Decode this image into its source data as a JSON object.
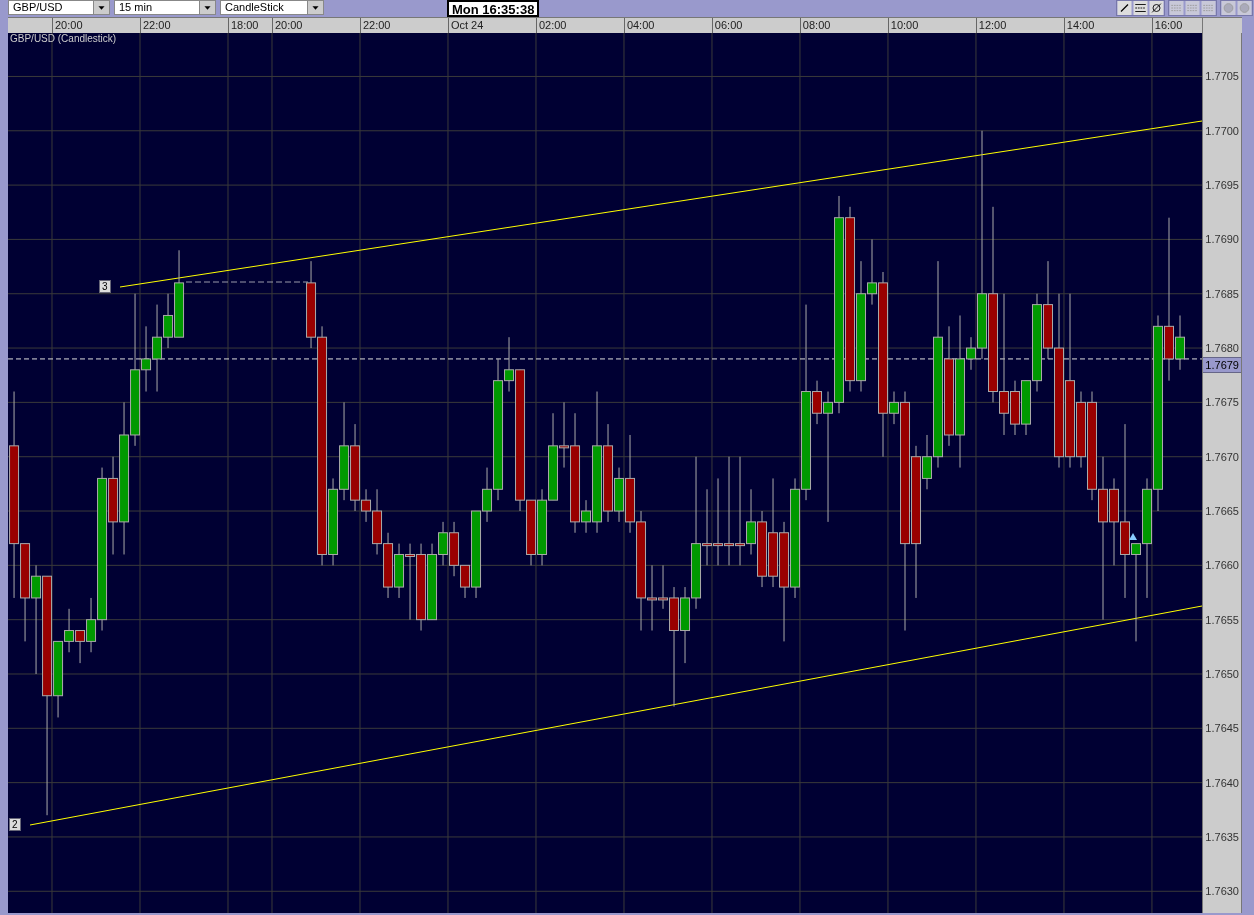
{
  "toolbar": {
    "symbol_dropdown": "GBP/USD",
    "interval_dropdown": "15 min",
    "chart_type_dropdown": "CandleStick",
    "clock": "Mon 16:35:38"
  },
  "chart": {
    "trend_line_labels": [
      "3",
      "2"
    ],
    "time_labels": [
      "20:00",
      "22:00",
      "18:00",
      "20:00",
      "22:00",
      "Oct 24",
      "02:00",
      "04:00",
      "06:00",
      "08:00",
      "10:00",
      "12:00",
      "14:00",
      "16:00"
    ],
    "chart_data": {
      "type": "candlestick",
      "title": "GBP/USD (Candlestick)",
      "categories": [
        null,
        null,
        null,
        null,
        null,
        null,
        null,
        null,
        null,
        null,
        null,
        null,
        null,
        null,
        null,
        null,
        null,
        null,
        null,
        null,
        null,
        null,
        null,
        null,
        null,
        null,
        null,
        null,
        null,
        null,
        null,
        null,
        null,
        null,
        null,
        null,
        null,
        null,
        null,
        null,
        null,
        null,
        null,
        null,
        null,
        null,
        null,
        null,
        null,
        null,
        null,
        null,
        null,
        null,
        null,
        null,
        null,
        null,
        null,
        null,
        null,
        null,
        null,
        null,
        null,
        null,
        null,
        null,
        null,
        null,
        null,
        null,
        null,
        null,
        null,
        null,
        null,
        null,
        null,
        null,
        null,
        null,
        null,
        null,
        null,
        null,
        null,
        null,
        null,
        null,
        null,
        null,
        null,
        null,
        null,
        null,
        null,
        null,
        null,
        null,
        null,
        null,
        null,
        null,
        null,
        null,
        null
      ],
      "grid": true,
      "ref_lines": [
        {
          "axis": "y",
          "value": 1.7679,
          "label": "1.7679"
        }
      ],
      "ohlc": [
        [
          1.7671,
          1.7676,
          1.7657,
          1.7662
        ],
        [
          1.7662,
          1.7662,
          1.7653,
          1.7657
        ],
        [
          1.7657,
          1.766,
          1.765,
          1.7659
        ],
        [
          1.7659,
          1.7659,
          1.7637,
          1.7648
        ],
        [
          1.7648,
          1.7653,
          1.7646,
          1.7653
        ],
        [
          1.7653,
          1.7656,
          1.7652,
          1.7654
        ],
        [
          1.7654,
          1.7654,
          1.7651,
          1.7653
        ],
        [
          1.7653,
          1.7657,
          1.7652,
          1.7655
        ],
        [
          1.7655,
          1.7669,
          1.7654,
          1.7668
        ],
        [
          1.7668,
          1.767,
          1.7661,
          1.7664
        ],
        [
          1.7664,
          1.7675,
          1.7661,
          1.7672
        ],
        [
          1.7672,
          1.7685,
          1.7671,
          1.7678
        ],
        [
          1.7678,
          1.7682,
          1.7676,
          1.7679
        ],
        [
          1.7679,
          1.7684,
          1.7676,
          1.7681
        ],
        [
          1.7681,
          1.7685,
          1.768,
          1.7683
        ],
        [
          1.7681,
          1.7689,
          1.7681,
          1.7686
        ],
        null,
        null,
        null,
        null,
        null,
        null,
        null,
        null,
        null,
        null,
        null,
        [
          1.7686,
          1.7688,
          1.768,
          1.7681
        ],
        [
          1.7681,
          1.7682,
          1.766,
          1.7661
        ],
        [
          1.7661,
          1.7668,
          1.766,
          1.7667
        ],
        [
          1.7667,
          1.7675,
          1.7666,
          1.7671
        ],
        [
          1.7671,
          1.7673,
          1.7665,
          1.7666
        ],
        [
          1.7666,
          1.7667,
          1.7664,
          1.7665
        ],
        [
          1.7665,
          1.7667,
          1.7661,
          1.7662
        ],
        [
          1.7662,
          1.7663,
          1.7657,
          1.7658
        ],
        [
          1.7658,
          1.7662,
          1.7657,
          1.7661
        ],
        [
          1.7661,
          1.7662,
          1.7655,
          1.7661
        ],
        [
          1.7661,
          1.7662,
          1.7654,
          1.7655
        ],
        [
          1.7655,
          1.7662,
          1.7655,
          1.7661
        ],
        [
          1.7661,
          1.7664,
          1.766,
          1.7663
        ],
        [
          1.7663,
          1.7664,
          1.7659,
          1.766
        ],
        [
          1.766,
          1.766,
          1.7657,
          1.7658
        ],
        [
          1.7658,
          1.7665,
          1.7657,
          1.7665
        ],
        [
          1.7665,
          1.7669,
          1.7664,
          1.7667
        ],
        [
          1.7667,
          1.7679,
          1.7666,
          1.7677
        ],
        [
          1.7677,
          1.7681,
          1.7676,
          1.7678
        ],
        [
          1.7678,
          1.7678,
          1.7665,
          1.7666
        ],
        [
          1.7666,
          1.7666,
          1.766,
          1.7661
        ],
        [
          1.7661,
          1.7667,
          1.766,
          1.7666
        ],
        [
          1.7666,
          1.7674,
          1.7666,
          1.7671
        ],
        [
          1.7671,
          1.7675,
          1.7669,
          1.7671
        ],
        [
          1.7671,
          1.7674,
          1.7663,
          1.7664
        ],
        [
          1.7664,
          1.7666,
          1.7663,
          1.7665
        ],
        [
          1.7664,
          1.7676,
          1.7663,
          1.7671
        ],
        [
          1.7671,
          1.7673,
          1.7664,
          1.7665
        ],
        [
          1.7665,
          1.7669,
          1.7664,
          1.7668
        ],
        [
          1.7668,
          1.7672,
          1.7663,
          1.7664
        ],
        [
          1.7664,
          1.7665,
          1.7654,
          1.7657
        ],
        [
          1.7657,
          1.766,
          1.7654,
          1.7657
        ],
        [
          1.7657,
          1.766,
          1.7656,
          1.7657
        ],
        [
          1.7657,
          1.7658,
          1.7647,
          1.7654
        ],
        [
          1.7654,
          1.7658,
          1.7651,
          1.7657
        ],
        [
          1.7657,
          1.767,
          1.7656,
          1.7662
        ],
        [
          1.7662,
          1.7667,
          1.766,
          1.7662
        ],
        [
          1.7662,
          1.7668,
          1.766,
          1.7662
        ],
        [
          1.7662,
          1.767,
          1.766,
          1.7662
        ],
        [
          1.7662,
          1.767,
          1.766,
          1.7662
        ],
        [
          1.7662,
          1.7667,
          1.7661,
          1.7664
        ],
        [
          1.7664,
          1.7665,
          1.7658,
          1.7659
        ],
        [
          1.7663,
          1.7668,
          1.7658,
          1.7659
        ],
        [
          1.7663,
          1.7664,
          1.7653,
          1.7658
        ],
        [
          1.7658,
          1.7668,
          1.7657,
          1.7667
        ],
        [
          1.7667,
          1.7684,
          1.7666,
          1.7676
        ],
        [
          1.7676,
          1.7677,
          1.7673,
          1.7674
        ],
        [
          1.7674,
          1.7676,
          1.7664,
          1.7675
        ],
        [
          1.7675,
          1.7694,
          1.7674,
          1.7692
        ],
        [
          1.7692,
          1.7693,
          1.7676,
          1.7677
        ],
        [
          1.7677,
          1.7688,
          1.7676,
          1.7685
        ],
        [
          1.7685,
          1.769,
          1.7684,
          1.7686
        ],
        [
          1.7686,
          1.7687,
          1.767,
          1.7674
        ],
        [
          1.7674,
          1.7676,
          1.7673,
          1.7675
        ],
        [
          1.7675,
          1.7676,
          1.7654,
          1.7662
        ],
        [
          1.767,
          1.7671,
          1.7657,
          1.7662
        ],
        [
          1.7668,
          1.7672,
          1.7667,
          1.767
        ],
        [
          1.767,
          1.7688,
          1.7669,
          1.7681
        ],
        [
          1.7679,
          1.7682,
          1.7671,
          1.7672
        ],
        [
          1.7672,
          1.7683,
          1.7669,
          1.7679
        ],
        [
          1.7679,
          1.7681,
          1.7678,
          1.768
        ],
        [
          1.768,
          1.77,
          1.7679,
          1.7685
        ],
        [
          1.7685,
          1.7693,
          1.7675,
          1.7676
        ],
        [
          1.7676,
          1.7685,
          1.7672,
          1.7674
        ],
        [
          1.7676,
          1.7677,
          1.7672,
          1.7673
        ],
        [
          1.7673,
          1.7677,
          1.7672,
          1.7677
        ],
        [
          1.7677,
          1.7685,
          1.7676,
          1.7684
        ],
        [
          1.7684,
          1.7688,
          1.7679,
          1.768
        ],
        [
          1.768,
          1.7685,
          1.7669,
          1.767
        ],
        [
          1.7677,
          1.7685,
          1.7669,
          1.767
        ],
        [
          1.7675,
          1.7676,
          1.7669,
          1.767
        ],
        [
          1.7675,
          1.7676,
          1.7666,
          1.7667
        ],
        [
          1.7667,
          1.767,
          1.7655,
          1.7664
        ],
        [
          1.7667,
          1.7668,
          1.766,
          1.7664
        ],
        [
          1.7664,
          1.7673,
          1.7657,
          1.7661
        ],
        [
          1.7661,
          1.7662,
          1.7653,
          1.7662
        ],
        [
          1.7662,
          1.7668,
          1.7657,
          1.7667
        ],
        [
          1.7667,
          1.7683,
          1.7665,
          1.7682
        ],
        [
          1.7682,
          1.7692,
          1.7677,
          1.7679
        ],
        [
          1.7679,
          1.7683,
          1.7678,
          1.7681
        ]
      ],
      "ylim": [
        1.7628,
        1.7709
      ],
      "yticks": [
        {
          "value": 1.7705,
          "label": "1.7705"
        },
        {
          "value": 1.77,
          "label": "1.7700"
        },
        {
          "value": 1.7695,
          "label": "1.7695"
        },
        {
          "value": 1.769,
          "label": "1.7690"
        },
        {
          "value": 1.7685,
          "label": "1.7685"
        },
        {
          "value": 1.768,
          "label": "1.7680"
        },
        {
          "value": 1.7675,
          "label": "1.7675"
        },
        {
          "value": 1.767,
          "label": "1.7670"
        },
        {
          "value": 1.7665,
          "label": "1.7665"
        },
        {
          "value": 1.766,
          "label": "1.7660"
        },
        {
          "value": 1.7655,
          "label": "1.7655"
        },
        {
          "value": 1.765,
          "label": "1.7650"
        },
        {
          "value": 1.7645,
          "label": "1.7645"
        },
        {
          "value": 1.764,
          "label": "1.7640"
        },
        {
          "value": 1.7635,
          "label": "1.7635"
        },
        {
          "value": 1.763,
          "label": "1.7630"
        }
      ]
    }
  }
}
